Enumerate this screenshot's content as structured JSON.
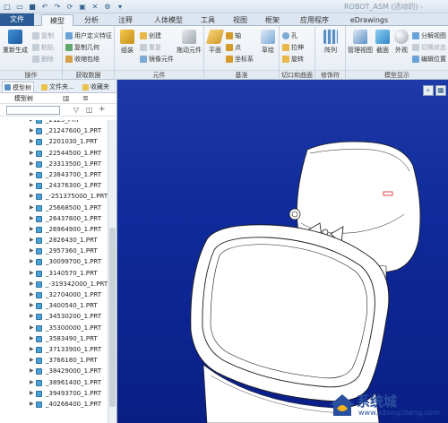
{
  "window": {
    "title": "ROBOT_ASM (活动的) -"
  },
  "ribbon_tabs": [
    "文件",
    "模型",
    "分析",
    "注释",
    "人体模型",
    "工具",
    "视图",
    "框架",
    "应用程序",
    "eDrawings"
  ],
  "ribbon": {
    "groups": {
      "operations": "操作",
      "get_data": "获取数据",
      "components": "元件",
      "datum": "基准",
      "cut_surface": "切口和曲面",
      "modifiers": "修饰符",
      "model_display": "模型显示"
    },
    "items": {
      "regenerate": "重新生成",
      "copy": "复制",
      "paste": "粘贴",
      "delete": "删除",
      "user_feature": "用户定义特征",
      "copy_geometry": "复制几何",
      "shrinkwrap": "收缩包络",
      "assemble": "组装",
      "create": "创建",
      "repeat": "重复",
      "mirror_component": "镜像元件",
      "drag_component": "拖动元件",
      "plane": "平面",
      "axis": "轴",
      "point": "点",
      "csys": "坐标系",
      "sketch": "草绘",
      "hole": "孔",
      "extrude": "拉伸",
      "revolve": "旋转",
      "pattern": "阵列",
      "manage_views": "管理视图",
      "section": "截面",
      "appearance": "外观",
      "explode_view": "分解视图",
      "toggle_status": "切换状态",
      "edit_position": "编辑位置"
    }
  },
  "navigator": {
    "tabs": [
      "模型树",
      "文件夹...",
      "收藏夹"
    ],
    "tree_header": "模型树",
    "parts": [
      "_2125_PRT",
      "_21247600_1.PRT",
      "_2201030_1.PRT",
      "_22544500_1.PRT",
      "_23313500_1.PRT",
      "_23843700_1.PRT",
      "_24376300_1.PRT",
      "_-251375000_1.PRT",
      "_25668500_1.PRT",
      "_26437800_1.PRT",
      "_26964900_1.PRT",
      "_2826430_1.PRT",
      "_2957360_1.PRT",
      "_30099700_1.PRT",
      "_3140570_1.PRT",
      "_-319342000_1.PRT",
      "_32704000_1.PRT",
      "_3400540_1.PRT",
      "_34530200_1.PRT",
      "_35300000_1.PRT",
      "_3583490_1.PRT",
      "_37133900_1.PRT",
      "_3766180_1.PRT",
      "_38429000_1.PRT",
      "_38961400_1.PRT",
      "_39493700_1.PRT",
      "_40266400_1.PRT"
    ]
  },
  "watermark": {
    "title": "系统城",
    "url": "www.xitongcheng.com"
  },
  "colors": {
    "file_tab": "#2b5c96",
    "viewport_bg": "#0f2a9a",
    "part_icon": "#4aa3d8"
  }
}
